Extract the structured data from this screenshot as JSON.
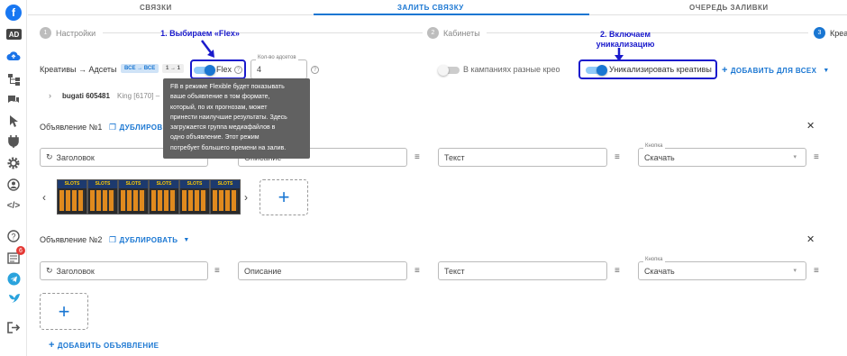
{
  "tabs": [
    "СВЯЗКИ",
    "ЗАЛИТЬ СВЯЗКУ",
    "ОЧЕРЕДЬ ЗАЛИВКИ"
  ],
  "steps": [
    {
      "num": "1",
      "label": "Настройки"
    },
    {
      "num": "2",
      "label": "Кабинеты"
    },
    {
      "num": "3",
      "label": "Креат"
    }
  ],
  "annotations": {
    "flex": "1. Выбираем «Flex»",
    "unique_line1": "2. Включаем",
    "unique_line2": "уникализацию"
  },
  "creatives_row": {
    "label": "Креативы → Адсеты",
    "chip_all": "ВСЕ → ВСЕ",
    "chip_one": "1 → 1",
    "flex_label": "Flex",
    "count_label": "Кол-во адсетов",
    "count_value": "4",
    "diff_creo_label": "В кампаниях разные крео",
    "uniq_label": "Уникализировать креативы",
    "add_all": "ДОБАВИТЬ ДЛЯ ВСЕХ"
  },
  "account": {
    "name": "bugati 605481",
    "extra": "King [6170] –"
  },
  "tooltip": {
    "line1": "FB в режиме Flexible будет показывать",
    "line2": "ваше объявление в том формате,",
    "line3": "который, по их прогнозам, может",
    "line4": "принести наилучшие результаты. Здесь",
    "line5": "загружается группа медиафайлов в",
    "line6": "одно объявление. Этот режим",
    "line7": "потребует большего времени на залив."
  },
  "ad1": {
    "title": "Объявление №1",
    "duplicate": "ДУБЛИРОВ",
    "headline": "Заголовок",
    "description": "Описание",
    "text": "Текст",
    "button_label": "Кнопка",
    "button_value": "Скачать",
    "thumb_text": "SLOTS"
  },
  "ad2": {
    "title": "Объявление №2",
    "duplicate": "ДУБЛИРОВАТЬ",
    "headline": "Заголовок",
    "description": "Описание",
    "text": "Текст",
    "button_label": "Кнопка",
    "button_value": "Скачать"
  },
  "add_ad": "ДОБАВИТЬ ОБЪЯВЛЕНИЕ",
  "sidebar": {
    "logo": "f",
    "ad": "AD",
    "badge": "6"
  },
  "colors": {
    "accent": "#1976d2",
    "annotation": "#1a1acc",
    "tooltip": "#616161"
  }
}
